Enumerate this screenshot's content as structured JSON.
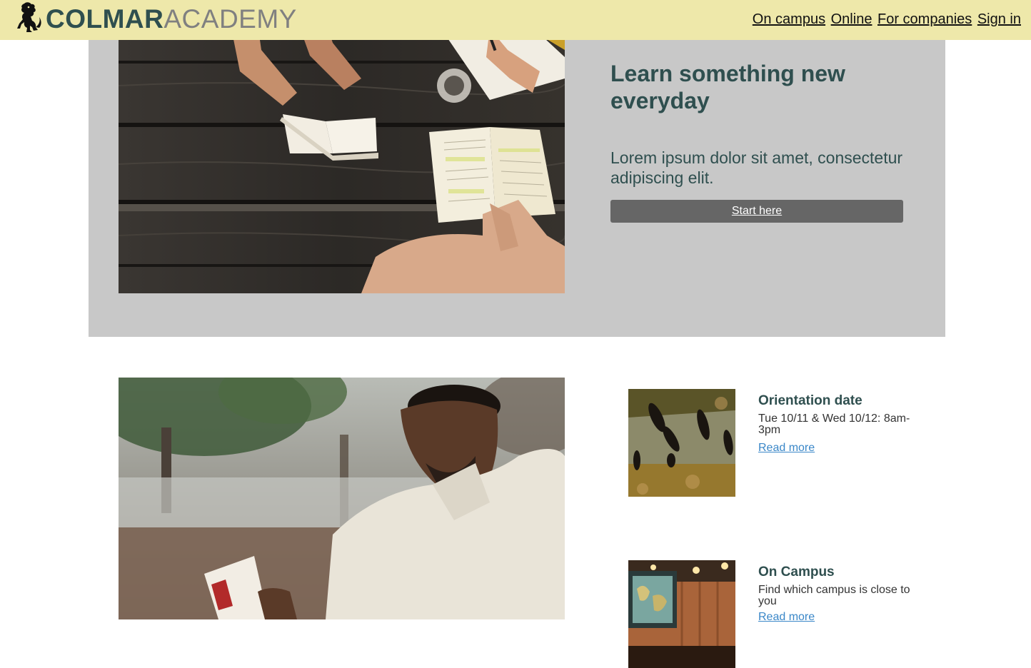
{
  "header": {
    "brand_strong": "COLMAR",
    "brand_light": "ACADEMY",
    "logo_icon": "lion-rampant-icon",
    "nav": [
      {
        "label": "On campus"
      },
      {
        "label": "Online"
      },
      {
        "label": "For companies"
      },
      {
        "label": "Sign in"
      }
    ],
    "background": "#eee8aa"
  },
  "hero": {
    "title": "Learn something new everyday",
    "text": "Lorem ipsum dolor sit amet, consectetur adipiscing elit.",
    "button_label": "Start here",
    "image": "students-reading-at-wooden-table-photo",
    "background": "#c8c8c8",
    "button_color": "#666666"
  },
  "feature": {
    "image": "man-reading-book-outdoors-photo"
  },
  "events": [
    {
      "title": "Orientation date",
      "description": "Tue 10/11 & Wed 10/12: 8am-3pm",
      "link": "Read more",
      "image": "people-walking-on-grass-aerial-photo"
    },
    {
      "title": "On Campus",
      "description": "Find which campus is close to you",
      "link": "Read more",
      "image": "campus-library-interior-photo"
    }
  ],
  "colors": {
    "heading": "#2f4f4f",
    "link": "#3a87c8"
  }
}
